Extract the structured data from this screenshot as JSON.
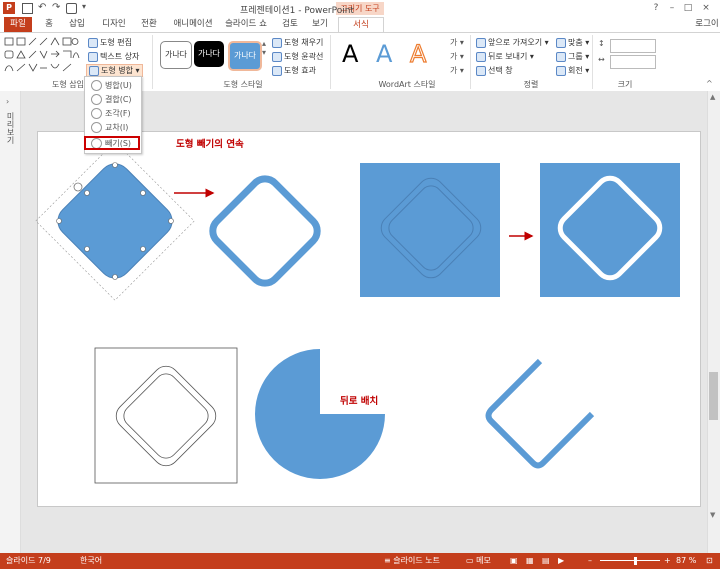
{
  "window": {
    "title": "프레젠테이션1 - PowerPoint",
    "context_tab_header": "그리기 도구",
    "sign_in": "로그이",
    "controls": [
      "?",
      "–",
      "□",
      "×"
    ]
  },
  "tabs": [
    {
      "label": "파일",
      "id": "file"
    },
    {
      "label": "홈",
      "id": "home"
    },
    {
      "label": "삽입",
      "id": "insert"
    },
    {
      "label": "디자인",
      "id": "design"
    },
    {
      "label": "전환",
      "id": "transitions"
    },
    {
      "label": "애니메이션",
      "id": "animations"
    },
    {
      "label": "슬라이드 쇼",
      "id": "slideshow"
    },
    {
      "label": "검토",
      "id": "review"
    },
    {
      "label": "보기",
      "id": "view"
    },
    {
      "label": "서식",
      "id": "format"
    }
  ],
  "ribbon": {
    "insert_shapes": {
      "label": "도형 삽입",
      "edit_shape": "도형 편집",
      "text_box": "텍스트 상자",
      "merge_shapes": "도형 병합"
    },
    "shape_styles": {
      "label": "도형 스타일",
      "presets": [
        "가나다",
        "가나다",
        "가나다"
      ],
      "fill": "도형 채우기",
      "outline": "도형 윤곽선",
      "effects": "도형 효과"
    },
    "wordart_styles": {
      "label": "WordArt 스타일",
      "letters": [
        "A",
        "A",
        "A"
      ]
    },
    "arrange": {
      "label": "정렬",
      "bring_forward": "앞으로 가져오기",
      "send_backward": "뒤로 보내기",
      "selection_pane": "선택 창",
      "align": "맞춤",
      "group": "그룹",
      "rotate": "회전"
    },
    "size": {
      "label": "크기"
    }
  },
  "merge_menu": {
    "items": [
      "병합(U)",
      "결합(C)",
      "조각(F)",
      "교차(I)",
      "빼기(S)"
    ],
    "highlighted_index": 4
  },
  "left_pane": {
    "label": "미리보기"
  },
  "slide": {
    "annotation_subtract": "도형 빼기의 연속",
    "annotation_send_back": "뒤로 배치",
    "colors": {
      "shape_fill": "#5b9bd5",
      "arrow": "#c00000",
      "annotation": "#c00000"
    }
  },
  "status": {
    "slide_number": "슬라이드 7/9",
    "language": "한국어",
    "notes": "슬라이드 노트",
    "comments": "메모",
    "zoom": "87 %",
    "zoom_level": 0.58
  }
}
